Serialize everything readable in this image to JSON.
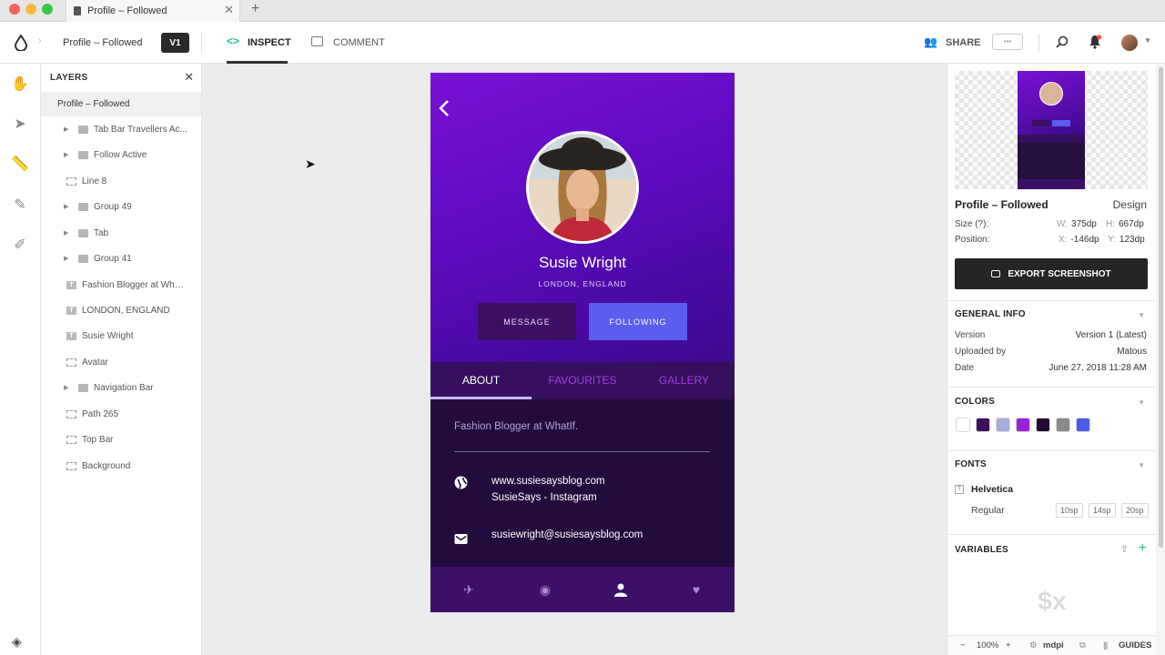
{
  "window": {
    "tab_title": "Profile – Followed",
    "close_glyph": "✕",
    "new_tab_glyph": "+"
  },
  "toolbar": {
    "project_title": "Profile – Followed",
    "version_badge": "V1",
    "inspect_label": "INSPECT",
    "comment_label": "COMMENT",
    "share_label": "SHARE",
    "more_label": "•••"
  },
  "layers": {
    "header": "LAYERS",
    "close_glyph": "✕",
    "root": "Profile – Followed",
    "items": [
      {
        "label": "Tab Bar Travellers Ac...",
        "kind": "folder"
      },
      {
        "label": "Follow Active",
        "kind": "folder"
      },
      {
        "label": "Line 8",
        "kind": "rect"
      },
      {
        "label": "Group 49",
        "kind": "folder"
      },
      {
        "label": "Tab",
        "kind": "folder"
      },
      {
        "label": "Group 41",
        "kind": "folder"
      },
      {
        "label": "Fashion Blogger at Wha...",
        "kind": "text"
      },
      {
        "label": "LONDON, ENGLAND",
        "kind": "text"
      },
      {
        "label": "Susie Wright",
        "kind": "text"
      },
      {
        "label": "Avatar",
        "kind": "rect"
      },
      {
        "label": "Navigation Bar",
        "kind": "folder"
      },
      {
        "label": "Path 265",
        "kind": "rect"
      },
      {
        "label": "Top Bar",
        "kind": "rect"
      },
      {
        "label": "Background",
        "kind": "rect"
      }
    ]
  },
  "phone": {
    "name": "Susie Wright",
    "location": "LONDON, ENGLAND",
    "message_button": "MESSAGE",
    "following_button": "FOLLOWING",
    "tabs": [
      "ABOUT",
      "FAVOURITES",
      "GALLERY"
    ],
    "bio": "Fashion Blogger at WhatIf.",
    "website": "www.susiesaysblog.com",
    "instagram": "SusieSays - Instagram",
    "email": "susiewright@susiesaysblog.com"
  },
  "inspect": {
    "artboard_name": "Profile – Followed",
    "design_label": "Design",
    "size_label": "Size (?):",
    "w_key": "W:",
    "w_val": "375dp",
    "h_key": "H:",
    "h_val": "667dp",
    "position_label": "Position:",
    "x_key": "X:",
    "x_val": "-146dp",
    "y_key": "Y:",
    "y_val": "123dp",
    "export_label": "EXPORT SCREENSHOT",
    "general_info": {
      "header": "GENERAL INFO",
      "version_label": "Version",
      "version_value": "Version 1 (Latest)",
      "uploaded_label": "Uploaded by",
      "uploaded_value": "Matous",
      "date_label": "Date",
      "date_value": "June 27, 2018 11:28 AM"
    },
    "colors": {
      "header": "COLORS",
      "swatches": [
        "#ffffff",
        "#3d0f5e",
        "#a7acdf",
        "#9c1fdc",
        "#220a35",
        "#8a8a8a",
        "#4b5be8"
      ]
    },
    "fonts": {
      "header": "FONTS",
      "family": "Helvetica",
      "style": "Regular",
      "sizes": [
        "10sp",
        "14sp",
        "20sp"
      ]
    },
    "variables": {
      "header": "VARIABLES",
      "placeholder": "$x"
    },
    "footer": {
      "minus": "−",
      "zoom": "100%",
      "plus": "+",
      "density": "mdpi",
      "guides": "GUIDES"
    }
  }
}
